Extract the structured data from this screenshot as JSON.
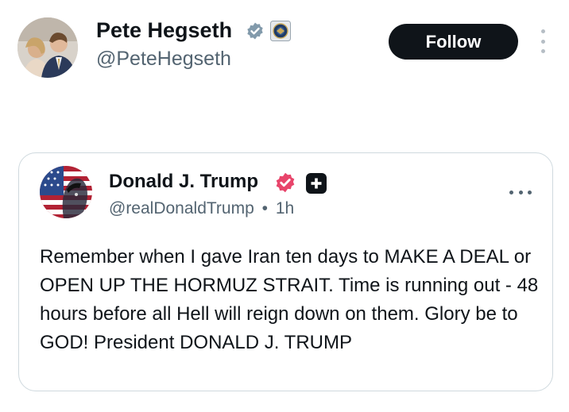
{
  "post": {
    "author_name": "Pete Hegseth",
    "author_handle": "@PeteHegseth",
    "verified_icon": "verified-badge-gray",
    "affiliation_icon": "government-seal",
    "follow_label": "Follow",
    "more_icon": "more-vertical-icon"
  },
  "quoted_post": {
    "author_name": "Donald J. Trump",
    "author_handle": "@realDonaldTrump",
    "separator": "•",
    "time": "1h",
    "verified_icon": "verified-badge-pink",
    "plus_icon": "plus-badge",
    "more_icon": "more-horizontal-icon",
    "text": "Remember when I gave Iran ten days to MAKE A DEAL or OPEN UP THE HORMUZ STRAIT. Time is running out - 48 hours before all Hell will reign down on them. Glory be to GOD! President DONALD J. TRUMP"
  },
  "colors": {
    "text_primary": "#0f1419",
    "text_secondary": "#536471",
    "border": "#cfd9de",
    "verified_gray": "#829aab",
    "verified_pink": "#e8456b"
  }
}
